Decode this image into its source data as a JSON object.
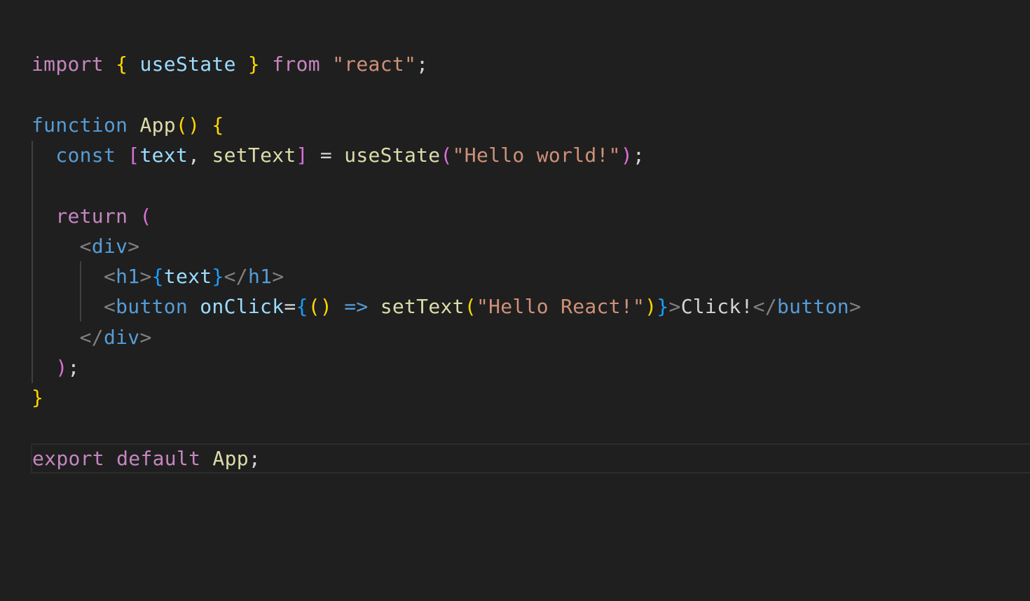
{
  "editor": {
    "background": "#1f1f1f",
    "lines": [
      [
        {
          "t": "import",
          "c": "tok-keyword-ctrl"
        },
        {
          "t": " ",
          "c": "tok-punct"
        },
        {
          "t": "{",
          "c": "tok-brace1"
        },
        {
          "t": " ",
          "c": "tok-punct"
        },
        {
          "t": "useState",
          "c": "tok-var"
        },
        {
          "t": " ",
          "c": "tok-punct"
        },
        {
          "t": "}",
          "c": "tok-brace1"
        },
        {
          "t": " ",
          "c": "tok-punct"
        },
        {
          "t": "from",
          "c": "tok-keyword-ctrl"
        },
        {
          "t": " ",
          "c": "tok-punct"
        },
        {
          "t": "\"react\"",
          "c": "tok-str"
        },
        {
          "t": ";",
          "c": "tok-punct"
        }
      ],
      [],
      [
        {
          "t": "function",
          "c": "tok-keyword"
        },
        {
          "t": " ",
          "c": "tok-punct"
        },
        {
          "t": "App",
          "c": "tok-func"
        },
        {
          "t": "()",
          "c": "tok-brace1"
        },
        {
          "t": " ",
          "c": "tok-punct"
        },
        {
          "t": "{",
          "c": "tok-brace1"
        }
      ],
      [
        {
          "t": "  ",
          "c": "tok-punct"
        },
        {
          "t": "const",
          "c": "tok-keyword"
        },
        {
          "t": " ",
          "c": "tok-punct"
        },
        {
          "t": "[",
          "c": "tok-brace2"
        },
        {
          "t": "text",
          "c": "tok-var"
        },
        {
          "t": ", ",
          "c": "tok-punct"
        },
        {
          "t": "setText",
          "c": "tok-func"
        },
        {
          "t": "]",
          "c": "tok-brace2"
        },
        {
          "t": " = ",
          "c": "tok-punct"
        },
        {
          "t": "useState",
          "c": "tok-func"
        },
        {
          "t": "(",
          "c": "tok-brace2"
        },
        {
          "t": "\"Hello world!\"",
          "c": "tok-str"
        },
        {
          "t": ")",
          "c": "tok-brace2"
        },
        {
          "t": ";",
          "c": "tok-punct"
        }
      ],
      [],
      [
        {
          "t": "  ",
          "c": "tok-punct"
        },
        {
          "t": "return",
          "c": "tok-keyword-ctrl"
        },
        {
          "t": " ",
          "c": "tok-punct"
        },
        {
          "t": "(",
          "c": "tok-brace2"
        }
      ],
      [
        {
          "t": "    ",
          "c": "tok-punct"
        },
        {
          "t": "<",
          "c": "tok-tagbr"
        },
        {
          "t": "div",
          "c": "tok-tag"
        },
        {
          "t": ">",
          "c": "tok-tagbr"
        }
      ],
      [
        {
          "t": "      ",
          "c": "tok-punct"
        },
        {
          "t": "<",
          "c": "tok-tagbr"
        },
        {
          "t": "h1",
          "c": "tok-tag"
        },
        {
          "t": ">",
          "c": "tok-tagbr"
        },
        {
          "t": "{",
          "c": "tok-brace3"
        },
        {
          "t": "text",
          "c": "tok-var"
        },
        {
          "t": "}",
          "c": "tok-brace3"
        },
        {
          "t": "</",
          "c": "tok-tagbr"
        },
        {
          "t": "h1",
          "c": "tok-tag"
        },
        {
          "t": ">",
          "c": "tok-tagbr"
        }
      ],
      [
        {
          "t": "      ",
          "c": "tok-punct"
        },
        {
          "t": "<",
          "c": "tok-tagbr"
        },
        {
          "t": "button",
          "c": "tok-tag"
        },
        {
          "t": " ",
          "c": "tok-punct"
        },
        {
          "t": "onClick",
          "c": "tok-var"
        },
        {
          "t": "=",
          "c": "tok-punct"
        },
        {
          "t": "{",
          "c": "tok-brace3"
        },
        {
          "t": "()",
          "c": "tok-brace1"
        },
        {
          "t": " ",
          "c": "tok-punct"
        },
        {
          "t": "=>",
          "c": "tok-keyword"
        },
        {
          "t": " ",
          "c": "tok-punct"
        },
        {
          "t": "setText",
          "c": "tok-func"
        },
        {
          "t": "(",
          "c": "tok-brace1"
        },
        {
          "t": "\"Hello React!\"",
          "c": "tok-str"
        },
        {
          "t": ")",
          "c": "tok-brace1"
        },
        {
          "t": "}",
          "c": "tok-brace3"
        },
        {
          "t": ">",
          "c": "tok-tagbr"
        },
        {
          "t": "Click!",
          "c": "tok-text"
        },
        {
          "t": "</",
          "c": "tok-tagbr"
        },
        {
          "t": "button",
          "c": "tok-tag"
        },
        {
          "t": ">",
          "c": "tok-tagbr"
        }
      ],
      [
        {
          "t": "    ",
          "c": "tok-punct"
        },
        {
          "t": "</",
          "c": "tok-tagbr"
        },
        {
          "t": "div",
          "c": "tok-tag"
        },
        {
          "t": ">",
          "c": "tok-tagbr"
        }
      ],
      [
        {
          "t": "  ",
          "c": "tok-punct"
        },
        {
          "t": ")",
          "c": "tok-brace2"
        },
        {
          "t": ";",
          "c": "tok-punct"
        }
      ],
      [
        {
          "t": "}",
          "c": "tok-brace1"
        }
      ],
      [],
      [
        {
          "t": "export",
          "c": "tok-keyword-ctrl"
        },
        {
          "t": " ",
          "c": "tok-punct"
        },
        {
          "t": "default",
          "c": "tok-keyword-ctrl"
        },
        {
          "t": " ",
          "c": "tok-punct"
        },
        {
          "t": "App",
          "c": "tok-func"
        },
        {
          "t": ";",
          "c": "tok-punct"
        }
      ]
    ],
    "current_line_index": 13
  }
}
